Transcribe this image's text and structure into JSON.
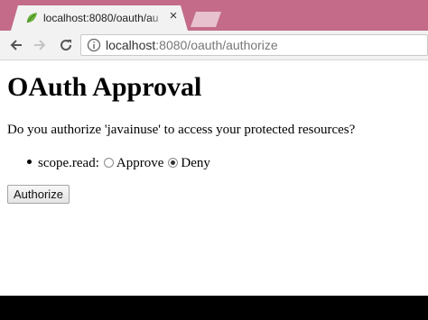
{
  "browser": {
    "tab": {
      "title": "localhost:8080/oauth/au",
      "close_glyph": "×",
      "favicon": "leaf-icon"
    },
    "toolbar": {
      "back_icon": "arrow-left-icon",
      "forward_icon": "arrow-right-icon",
      "reload_icon": "reload-icon",
      "info_icon": "info-icon",
      "url_host": "localhost",
      "url_path": ":8080/oauth/authorize"
    },
    "colors": {
      "tab_strip": "#c36b88",
      "toolbar": "#f2f2f2"
    }
  },
  "page": {
    "title": "OAuth Approval",
    "question": "Do you authorize 'javainuse' to access your protected resources?",
    "scope_label": "scope.read:",
    "options": {
      "approve": "Approve",
      "deny": "Deny",
      "selected": "Deny"
    },
    "submit_label": "Authorize"
  }
}
